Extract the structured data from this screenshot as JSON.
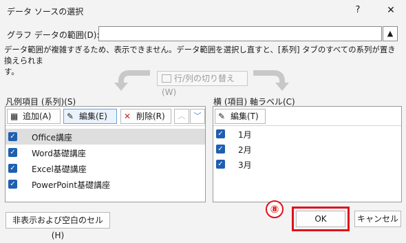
{
  "window": {
    "title": "データ ソースの選択",
    "help_label": "?",
    "close_label": "✕"
  },
  "range": {
    "label": "グラフ データの範囲(D):",
    "value": "",
    "collapse_label": "▲"
  },
  "warning": "データ範囲が複雑すぎるため、表示できません。データ範囲を選択し直すと、[系列] タブのすべての系列が置き換えられま\nす。",
  "switch_button": "行/列の切り替え(W)",
  "series_panel": {
    "label": "凡例項目 (系列)(S)",
    "add": "追加(A)",
    "edit": "編集(E)",
    "remove": "削除(R)",
    "up": "︿",
    "down": "﹀",
    "items": [
      "Office講座",
      "Word基礎講座",
      "Excel基礎講座",
      "PowerPoint基礎講座"
    ]
  },
  "axis_panel": {
    "label": "横 (項目) 軸ラベル(C)",
    "edit": "編集(T)",
    "items": [
      "1月",
      "2月",
      "3月"
    ]
  },
  "footer": {
    "hidden_cells": "非表示および空白のセル(H)",
    "ok": "OK",
    "cancel": "キャンセル",
    "step_badge": "⑧"
  },
  "colors": {
    "highlight": "#e0101a",
    "checkbox": "#1f5fb0",
    "accent": "#4a7fc1"
  }
}
